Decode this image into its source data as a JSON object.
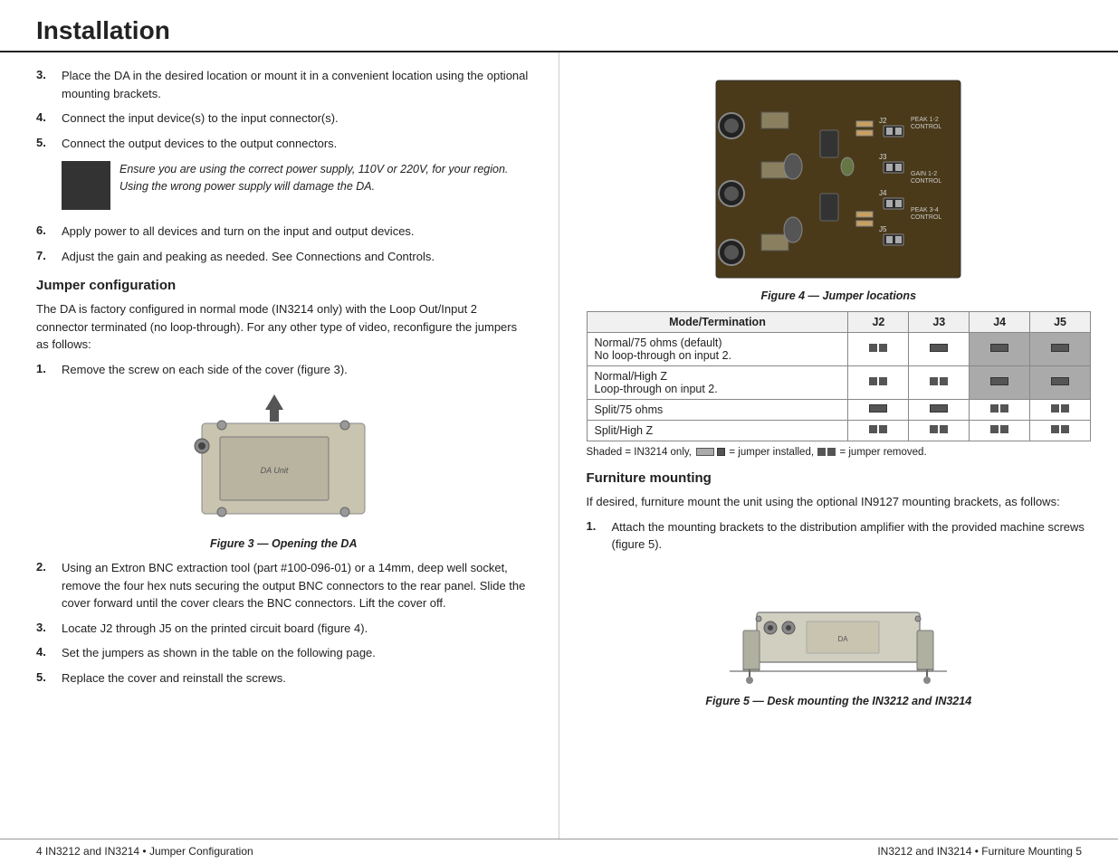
{
  "header": {
    "title": "Installation"
  },
  "left_col": {
    "steps_intro": [
      {
        "num": "3.",
        "text": "Place the DA in the desired location or mount it in a convenient location using the optional mounting brackets."
      },
      {
        "num": "4.",
        "text": "Connect the input device(s) to the input connector(s)."
      },
      {
        "num": "5.",
        "text": "Connect the output devices to the output connectors."
      }
    ],
    "warning": "Ensure you are using the correct power supply, 110V or 220V, for your region.  Using the wrong power supply will damage the DA.",
    "steps_mid": [
      {
        "num": "6.",
        "text": "Apply power to all devices and turn on the input and output devices."
      },
      {
        "num": "7.",
        "text": "Adjust the gain and peaking as needed.  See Connections and Controls."
      }
    ],
    "jumper_section": {
      "heading": "Jumper configuration",
      "text": "The DA is factory configured in normal mode (IN3214 only) with the Loop Out/Input 2 connector terminated (no loop-through). For any other type of video, reconfigure the jumpers as follows:",
      "steps": [
        {
          "num": "1.",
          "text": "Remove the screw on each side of the cover (figure 3)."
        },
        {
          "num": "2.",
          "text": "Using an Extron BNC extraction tool (part #100-096-01) or a 14mm, deep well socket, remove the four hex nuts securing the output BNC connectors to the rear panel.  Slide the cover forward until the cover clears the BNC connectors. Lift the cover off."
        },
        {
          "num": "3.",
          "text": "Locate J2 through J5 on the printed circuit board (figure 4)."
        },
        {
          "num": "4.",
          "text": "Set the jumpers as shown in the table on the following page."
        },
        {
          "num": "5.",
          "text": "Replace the cover and reinstall the screws."
        }
      ]
    },
    "figure3_caption": "Figure 3 — Opening the DA"
  },
  "right_col": {
    "figure4_caption": "Figure 4 — Jumper locations",
    "jumper_table": {
      "headers": [
        "Mode/Termination",
        "J2",
        "J3",
        "J4",
        "J5"
      ],
      "rows": [
        {
          "mode": "Normal/75 ohms (default)\nNo loop-through on input 2.",
          "j2": "removed",
          "j3": "installed",
          "j4": "installed_shaded",
          "j5": "installed_shaded"
        },
        {
          "mode": "Normal/High Z\nLoop-through on input 2.",
          "j2": "removed",
          "j3": "removed",
          "j4": "installed_shaded",
          "j5": "installed_shaded"
        },
        {
          "mode": "Split/75 ohms",
          "j2": "installed",
          "j3": "installed",
          "j4": "removed",
          "j5": "removed"
        },
        {
          "mode": "Split/High Z",
          "j2": "removed",
          "j3": "removed",
          "j4": "removed",
          "j5": "removed"
        }
      ],
      "note": "Shaded = IN3214 only,",
      "note_installed": "= jumper installed,",
      "note_removed": "= jumper removed."
    },
    "furniture_section": {
      "heading": "Furniture mounting",
      "text": "If desired, furniture mount the unit using the optional IN9127 mounting brackets, as follows:",
      "steps": [
        {
          "num": "1.",
          "text": "Attach the mounting brackets to the distribution amplifier with the provided machine screws (figure 5)."
        }
      ]
    },
    "figure5_caption": "Figure 5 — Desk mounting the IN3212 and IN3214"
  },
  "footer": {
    "left": "4     IN3212 and IN3214 • Jumper Configuration",
    "right": "IN3212 and IN3214 • Furniture Mounting     5"
  }
}
